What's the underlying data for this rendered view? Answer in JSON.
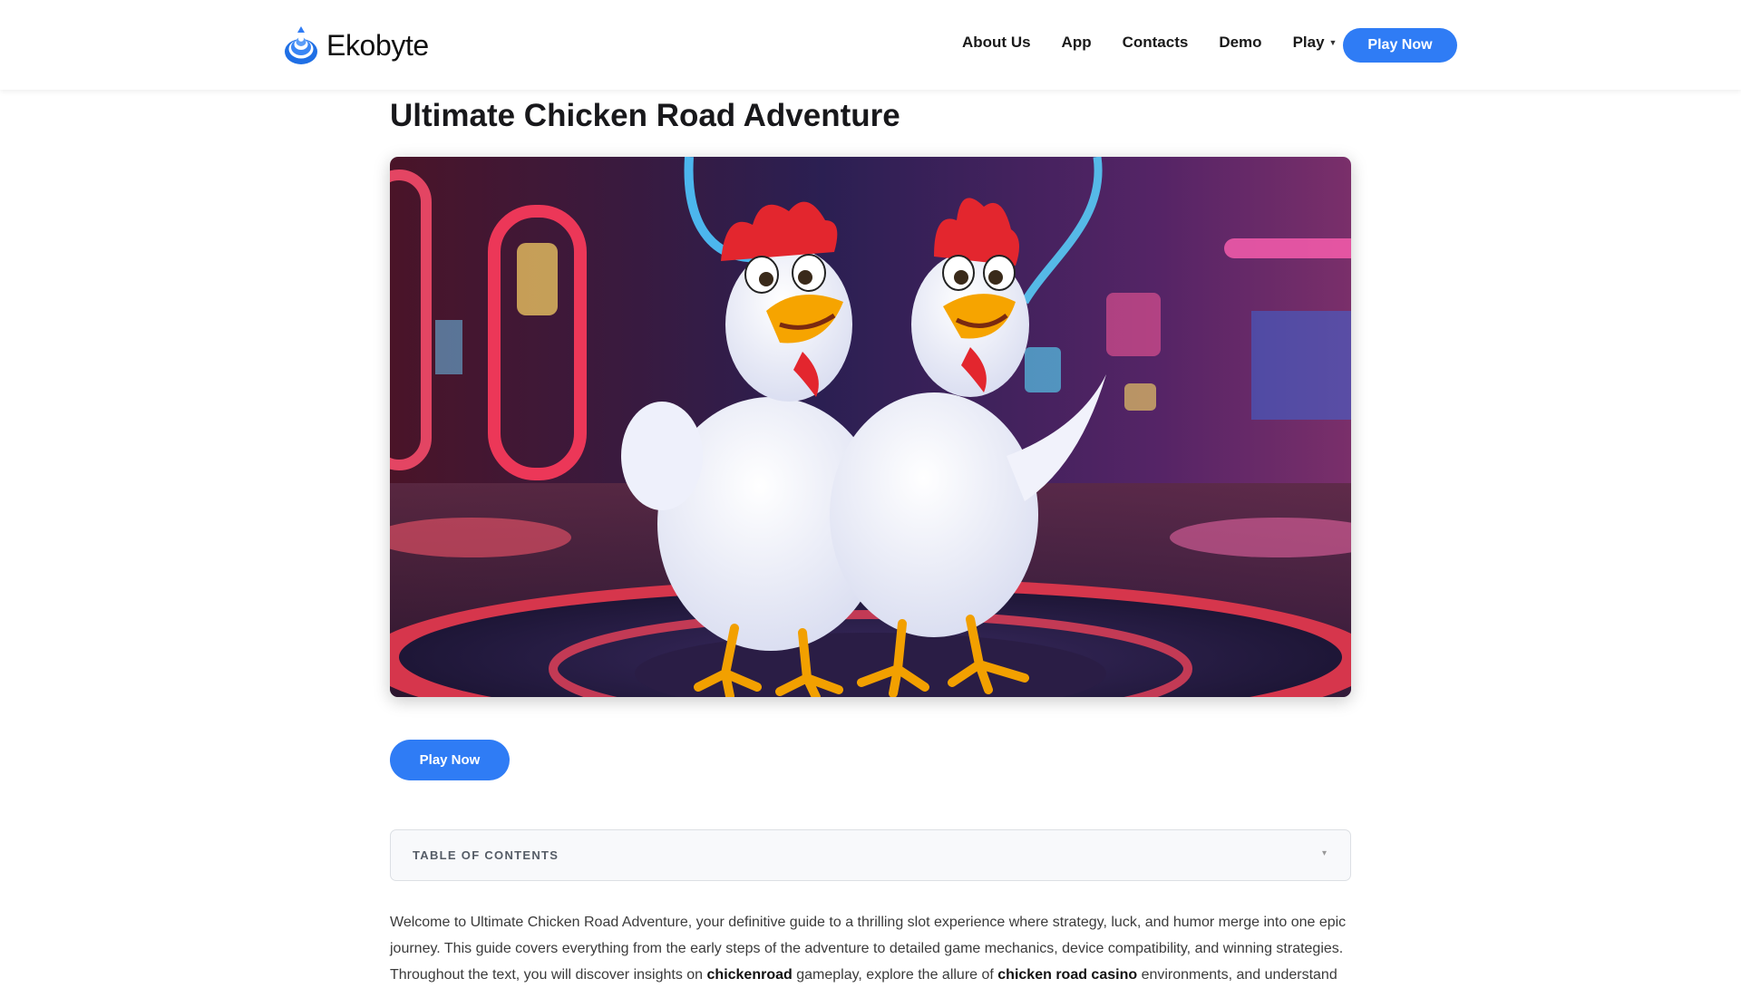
{
  "header": {
    "logo_text": "Ekobyte",
    "nav": [
      {
        "label": "About Us"
      },
      {
        "label": "App"
      },
      {
        "label": "Contacts"
      },
      {
        "label": "Demo"
      },
      {
        "label": "Play"
      }
    ],
    "cta_label": "Play Now"
  },
  "main": {
    "title": "Ultimate Chicken Road Adventure",
    "cta_label": "Play Now",
    "toc_label": "TABLE OF CONTENTS",
    "intro": {
      "part1": "Welcome to Ultimate Chicken Road Adventure, your definitive guide to a thrilling slot experience where strategy, luck, and humor merge into one epic journey. This guide covers everything from the early steps of the adventure to detailed game mechanics, device compatibility, and winning strategies. Throughout the text, you will discover insights on ",
      "bold1": "chickenroad",
      "part2": " gameplay, explore the allure of ",
      "bold2": "chicken road casino",
      "part3": " environments, and understand"
    }
  },
  "icons": {
    "logo": "spiral-logo-icon",
    "play_caret": "chevron-down-icon",
    "toc_toggle": "chevron-down-icon"
  },
  "colors": {
    "accent": "#2f7cf5",
    "text": "#18181b",
    "toc_bg": "#f8f9fb"
  }
}
